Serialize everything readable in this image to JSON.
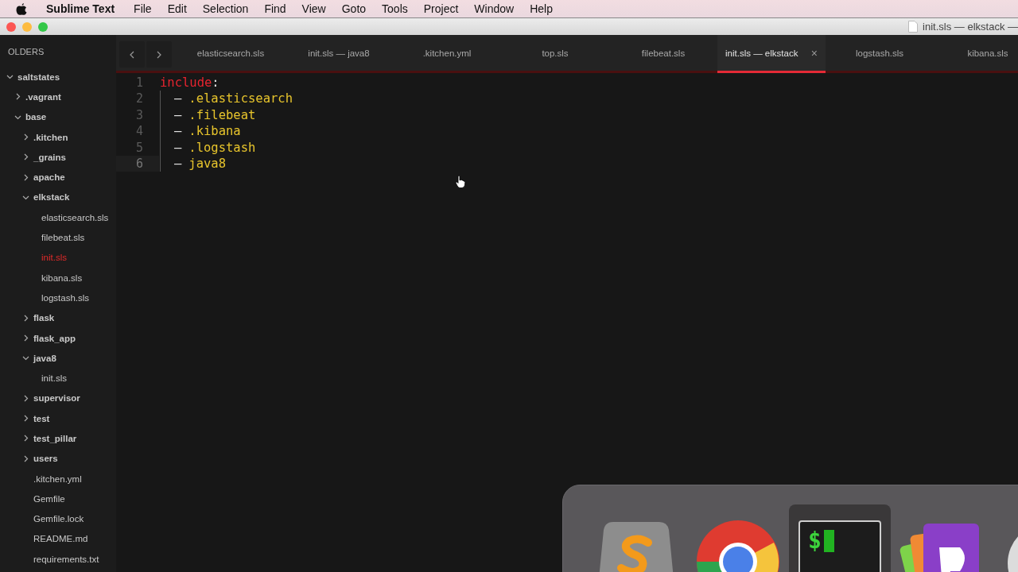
{
  "menu_bar": {
    "app_name": "Sublime Text",
    "items": [
      "File",
      "Edit",
      "Selection",
      "Find",
      "View",
      "Goto",
      "Tools",
      "Project",
      "Window",
      "Help"
    ]
  },
  "window": {
    "title": "init.sls — elkstack —"
  },
  "sidebar": {
    "header": "OLDERS",
    "tree": [
      {
        "label": "saltstates",
        "kind": "folder",
        "expanded": true,
        "selected": false,
        "children": [
          {
            "label": ".vagrant",
            "kind": "folder",
            "expanded": false,
            "selected": false
          },
          {
            "label": "base",
            "kind": "folder",
            "expanded": true,
            "selected": false,
            "children": [
              {
                "label": ".kitchen",
                "kind": "folder",
                "expanded": false,
                "selected": false
              },
              {
                "label": "_grains",
                "kind": "folder",
                "expanded": false,
                "selected": false
              },
              {
                "label": "apache",
                "kind": "folder",
                "expanded": false,
                "selected": false
              },
              {
                "label": "elkstack",
                "kind": "folder",
                "expanded": true,
                "selected": false,
                "children": [
                  {
                    "label": "elasticsearch.sls",
                    "kind": "file",
                    "selected": false
                  },
                  {
                    "label": "filebeat.sls",
                    "kind": "file",
                    "selected": false
                  },
                  {
                    "label": "init.sls",
                    "kind": "file",
                    "selected": true
                  },
                  {
                    "label": "kibana.sls",
                    "kind": "file",
                    "selected": false
                  },
                  {
                    "label": "logstash.sls",
                    "kind": "file",
                    "selected": false
                  }
                ]
              },
              {
                "label": "flask",
                "kind": "folder",
                "expanded": false,
                "selected": false
              },
              {
                "label": "flask_app",
                "kind": "folder",
                "expanded": false,
                "selected": false
              },
              {
                "label": "java8",
                "kind": "folder",
                "expanded": true,
                "selected": false,
                "children": [
                  {
                    "label": "init.sls",
                    "kind": "file",
                    "selected": false
                  }
                ]
              },
              {
                "label": "supervisor",
                "kind": "folder",
                "expanded": false,
                "selected": false
              },
              {
                "label": "test",
                "kind": "folder",
                "expanded": false,
                "selected": false
              },
              {
                "label": "test_pillar",
                "kind": "folder",
                "expanded": false,
                "selected": false
              },
              {
                "label": "users",
                "kind": "folder",
                "expanded": false,
                "selected": false
              },
              {
                "label": ".kitchen.yml",
                "kind": "file",
                "selected": false
              },
              {
                "label": "Gemfile",
                "kind": "file",
                "selected": false
              },
              {
                "label": "Gemfile.lock",
                "kind": "file",
                "selected": false
              },
              {
                "label": "README.md",
                "kind": "file",
                "selected": false
              },
              {
                "label": "requirements.txt",
                "kind": "file",
                "selected": false
              }
            ]
          }
        ]
      }
    ]
  },
  "tabs": [
    {
      "label": "elasticsearch.sls",
      "selected": false
    },
    {
      "label": "init.sls — java8",
      "selected": false
    },
    {
      "label": ".kitchen.yml",
      "selected": false
    },
    {
      "label": "top.sls",
      "selected": false
    },
    {
      "label": "filebeat.sls",
      "selected": false
    },
    {
      "label": "init.sls — elkstack",
      "selected": true,
      "close": "×"
    },
    {
      "label": "logstash.sls",
      "selected": false
    },
    {
      "label": "kibana.sls",
      "selected": false
    }
  ],
  "editor": {
    "lines": [
      {
        "number": "1",
        "current": false,
        "indented": false,
        "tokens": [
          {
            "kind": "keyword",
            "text": "include"
          },
          {
            "kind": "punct",
            "text": ":"
          }
        ]
      },
      {
        "number": "2",
        "current": false,
        "indented": true,
        "tokens": [
          {
            "kind": "punct",
            "text": "–"
          },
          {
            "kind": "string",
            "text": ".elasticsearch"
          }
        ]
      },
      {
        "number": "3",
        "current": false,
        "indented": true,
        "tokens": [
          {
            "kind": "punct",
            "text": "–"
          },
          {
            "kind": "string",
            "text": ".filebeat"
          }
        ]
      },
      {
        "number": "4",
        "current": false,
        "indented": true,
        "tokens": [
          {
            "kind": "punct",
            "text": "–"
          },
          {
            "kind": "string",
            "text": ".kibana"
          }
        ]
      },
      {
        "number": "5",
        "current": false,
        "indented": true,
        "tokens": [
          {
            "kind": "punct",
            "text": "–"
          },
          {
            "kind": "string",
            "text": ".logstash"
          }
        ]
      },
      {
        "number": "6",
        "current": true,
        "indented": true,
        "tokens": [
          {
            "kind": "punct",
            "text": "–"
          },
          {
            "kind": "string",
            "text": "java8"
          }
        ]
      }
    ]
  },
  "dock": {
    "items": [
      {
        "kind": "sublime",
        "active": false
      },
      {
        "kind": "chrome",
        "active": false
      },
      {
        "kind": "terminal",
        "active": true,
        "prompt": "$"
      },
      {
        "kind": "dimension",
        "active": false
      },
      {
        "kind": "disc",
        "active": false
      }
    ]
  }
}
